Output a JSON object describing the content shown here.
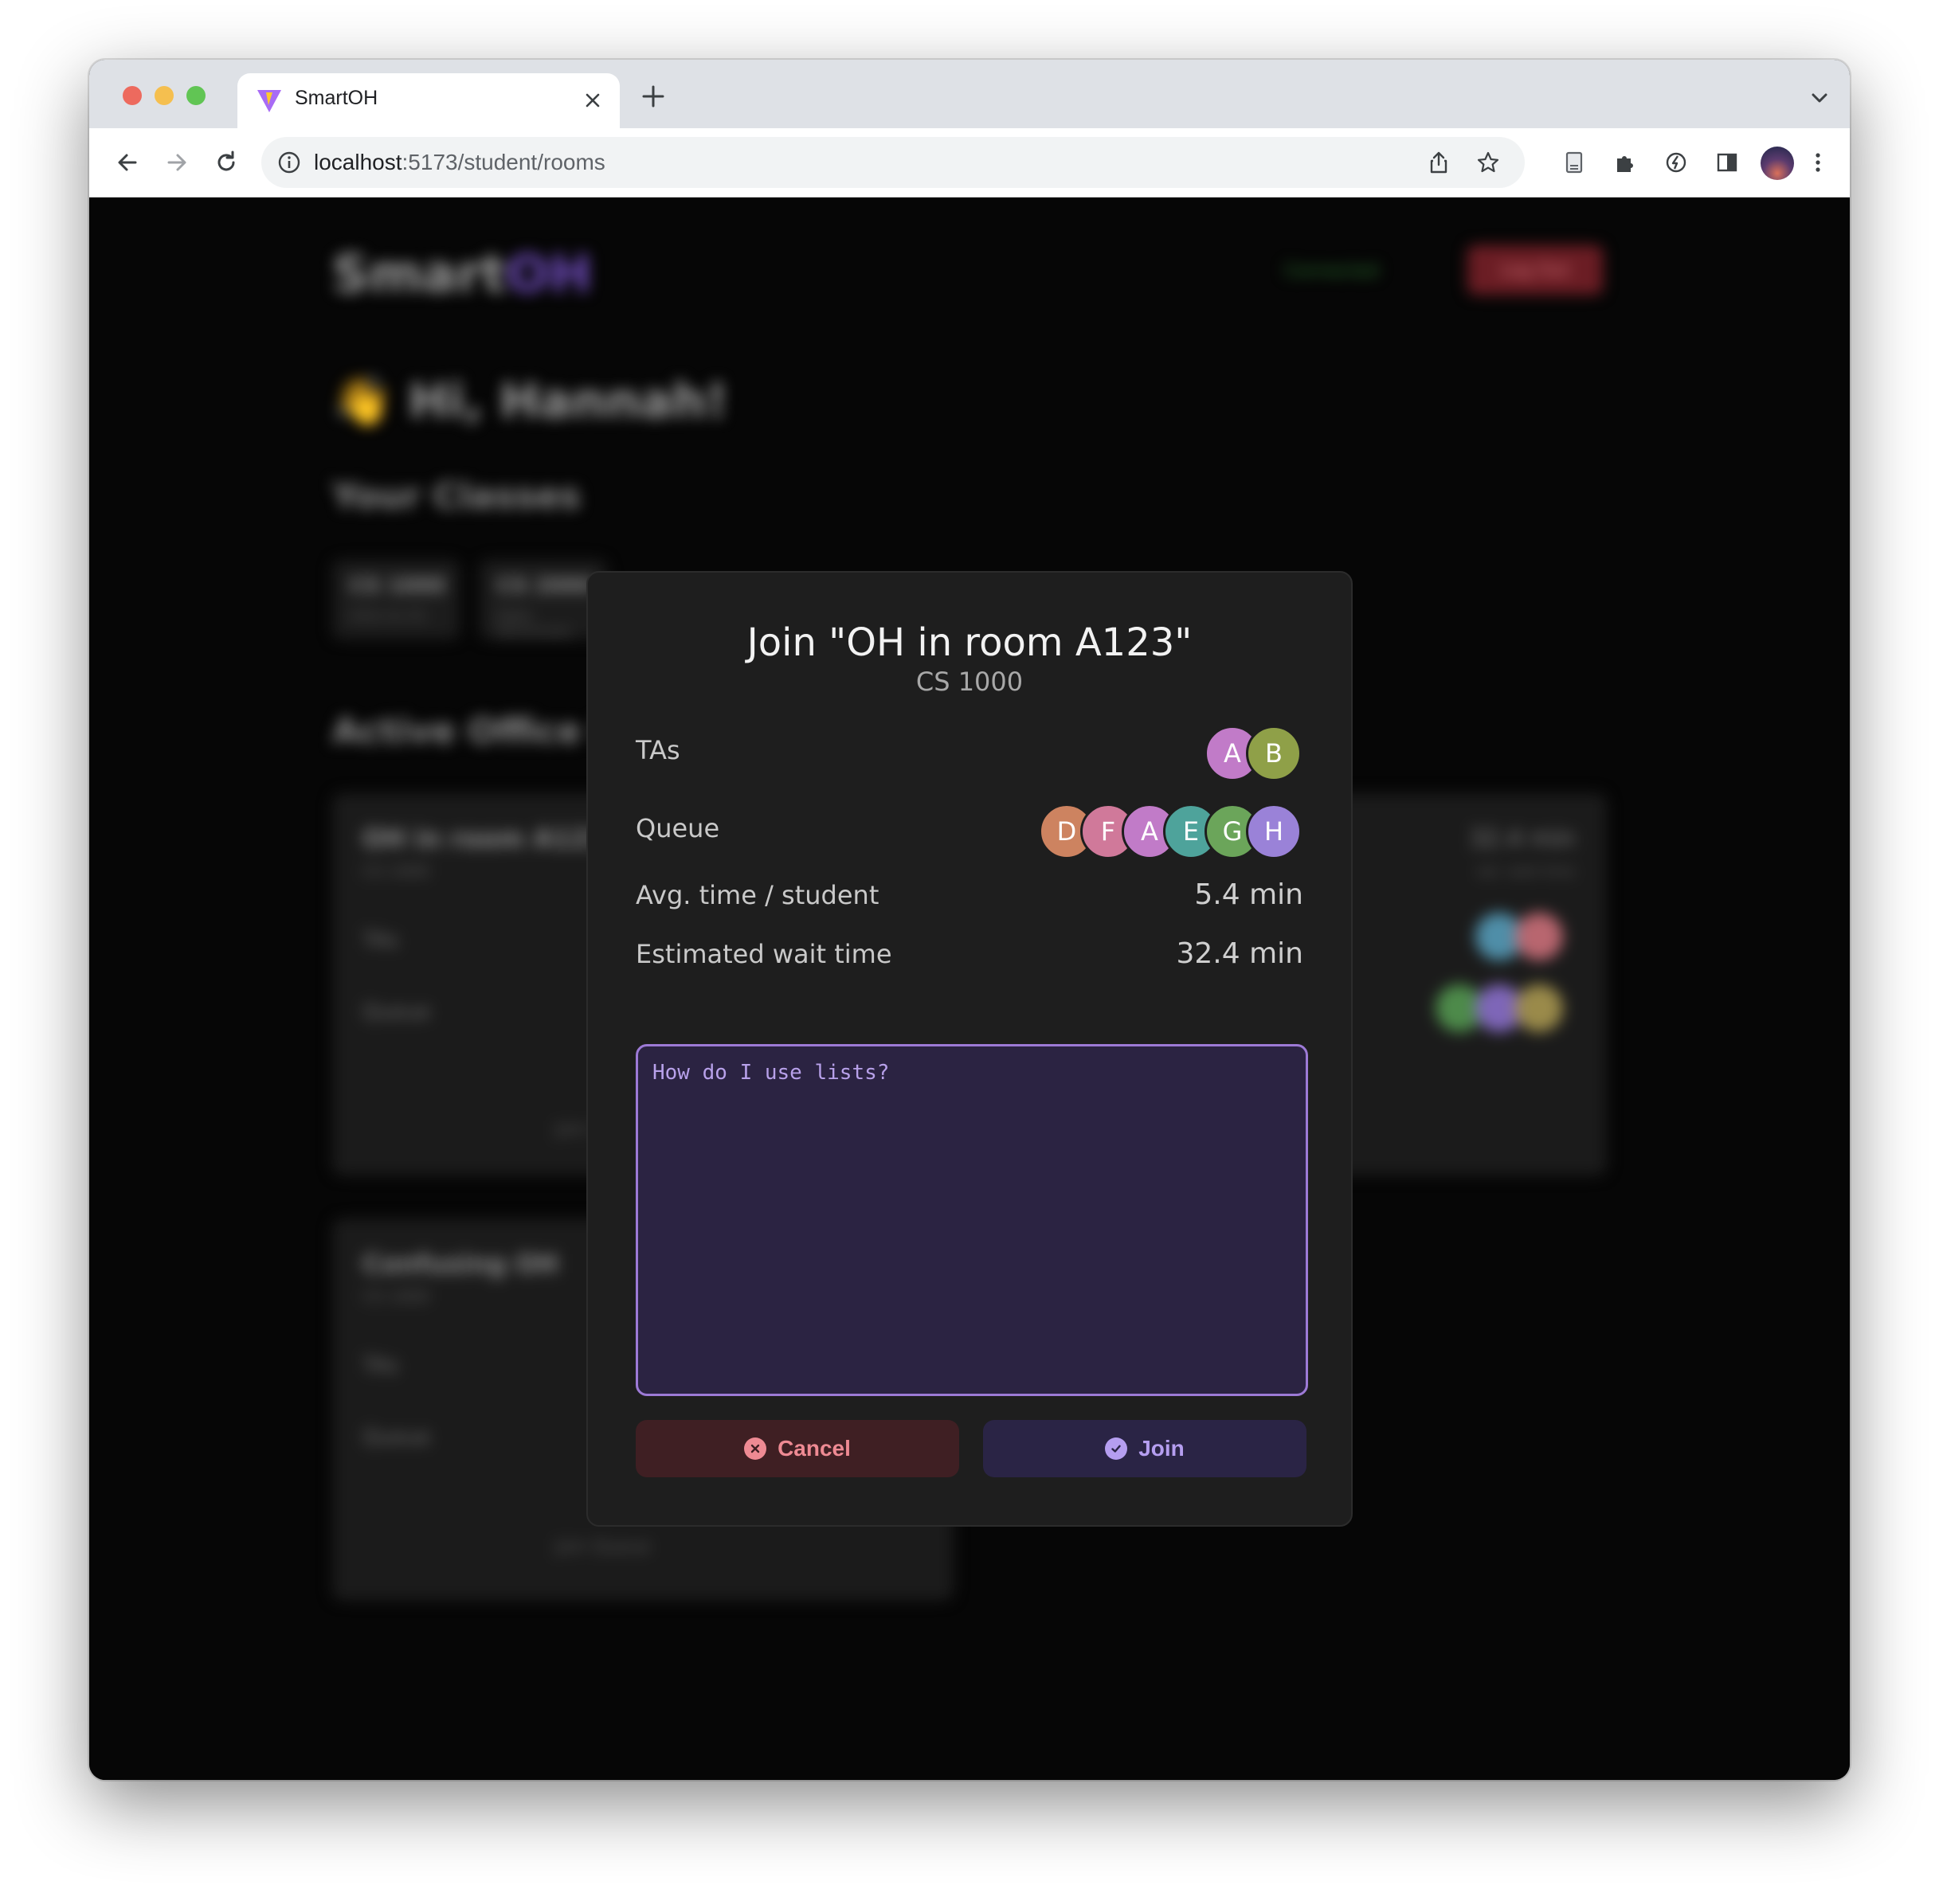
{
  "browser": {
    "tab_title": "SmartOH",
    "url_host": "localhost",
    "url_path": ":5173/student/rooms"
  },
  "background_page": {
    "logo_part1": "Smart",
    "logo_part2": "OH",
    "connected_status": "Connected",
    "logout_label": "Log Out",
    "greeting": "👋 Hi, Hannah!",
    "classes_heading": "Your Classes",
    "classes": [
      {
        "code": "CS 1000",
        "name": "Intro to CS"
      },
      {
        "code": "CS 2000",
        "name": "Data Structures"
      }
    ],
    "active_heading": "Active Office Hours",
    "rooms": [
      {
        "title": "OH in room A123",
        "course": "CS 1000",
        "tas_label": "TAs",
        "queue_label": "Queue",
        "wait": "32.4 min",
        "wait_label": "est. wait time",
        "action": "Join Queue"
      },
      {
        "title": "Confusing OH",
        "course": "CS 1000",
        "tas_label": "TAs",
        "queue_label": "Queue",
        "action": "Join Queue"
      }
    ]
  },
  "modal": {
    "title": "Join \"OH in room A123\"",
    "subtitle": "CS 1000",
    "tas_label": "TAs",
    "tas": [
      {
        "letter": "A",
        "color": "#c17bc8"
      },
      {
        "letter": "B",
        "color": "#8fa048"
      }
    ],
    "queue_label": "Queue",
    "queue": [
      {
        "letter": "D",
        "color": "#cd8360"
      },
      {
        "letter": "F",
        "color": "#d0799a"
      },
      {
        "letter": "A",
        "color": "#c17bc8"
      },
      {
        "letter": "E",
        "color": "#4ea39b"
      },
      {
        "letter": "G",
        "color": "#6ba55a"
      },
      {
        "letter": "H",
        "color": "#9a82d8"
      }
    ],
    "avg_label": "Avg. time / student",
    "avg_value": "5.4 min",
    "wait_label": "Estimated wait time",
    "wait_value": "32.4 min",
    "question_value": "How do I use lists?",
    "cancel_label": "Cancel",
    "join_label": "Join"
  },
  "colors": {
    "accent": "#9d7ad6",
    "cancel": "#ee8a93",
    "brand": "#6c4ab6"
  }
}
